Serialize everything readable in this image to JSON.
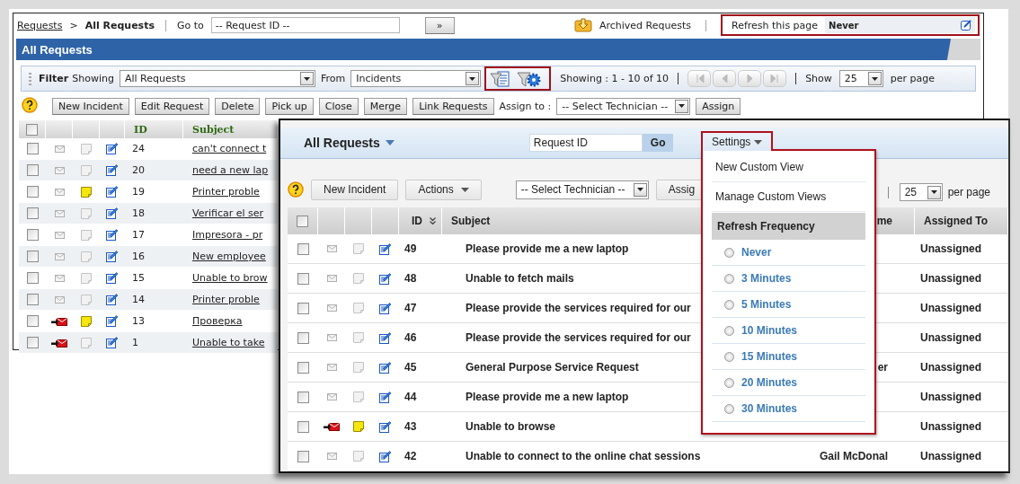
{
  "breadcrumb": {
    "link": "Requests",
    "separator": ">",
    "current": "All Requests"
  },
  "go_to": {
    "label": "Go to",
    "value": "-- Request ID --",
    "button": "»"
  },
  "archived_requests": "Archived Requests",
  "refresh": {
    "label": "Refresh this page",
    "value": "Never",
    "highlighted": true
  },
  "panel_title": "All Requests",
  "filter": {
    "title": "Filter",
    "showing_label": "Showing",
    "view": "All Requests",
    "from_label": "From",
    "module": "Incidents",
    "icons_highlighted": true,
    "range": "Showing : 1 - 10 of 10",
    "show_label": "Show",
    "per_page": "25",
    "per_page_label": "per page"
  },
  "toolbar": {
    "buttons": [
      "New Incident",
      "Edit Request",
      "Delete",
      "Pick up",
      "Close",
      "Merge",
      "Link Requests"
    ],
    "assign_label": "Assign to :",
    "technician": "-- Select Technician --",
    "assign_button": "Assign"
  },
  "table": {
    "select_all_checked": false,
    "columns": [
      "ID",
      "Subject"
    ],
    "rows": [
      {
        "checked": false,
        "new_mail": false,
        "note": false,
        "id": "24",
        "subject": "can't connect t"
      },
      {
        "checked": false,
        "new_mail": false,
        "note": false,
        "id": "20",
        "subject": "need a new lap"
      },
      {
        "checked": false,
        "new_mail": false,
        "note": true,
        "id": "19",
        "subject": "Printer proble"
      },
      {
        "checked": false,
        "new_mail": false,
        "note": false,
        "id": "18",
        "subject": "Verificar el ser"
      },
      {
        "checked": false,
        "new_mail": false,
        "note": false,
        "id": "17",
        "subject": "Impresora - pr"
      },
      {
        "checked": false,
        "new_mail": false,
        "note": false,
        "id": "16",
        "subject": "New employee"
      },
      {
        "checked": false,
        "new_mail": false,
        "note": false,
        "id": "15",
        "subject": "Unable to brow"
      },
      {
        "checked": false,
        "new_mail": false,
        "note": false,
        "id": "14",
        "subject": "Printer proble"
      },
      {
        "checked": false,
        "new_mail": true,
        "note": true,
        "id": "13",
        "subject": "Проверка"
      },
      {
        "checked": false,
        "new_mail": true,
        "note": false,
        "id": "1",
        "subject": "Unable to take"
      }
    ]
  },
  "popup": {
    "title": "All Requests",
    "search": "Request ID",
    "go": "Go",
    "new_button": "New Incident",
    "actions": "Actions",
    "technician": "-- Select Technician --",
    "assign": "Assig",
    "per_page": "25",
    "per_page_label": "per page",
    "select_all_checked": false,
    "columns": [
      "ID",
      "Subject",
      "me",
      "Assigned To"
    ],
    "rows": [
      {
        "checked": false,
        "new_mail": false,
        "note": false,
        "id": "49",
        "subject": "Please provide me a new laptop",
        "assigned": "Unassigned"
      },
      {
        "checked": false,
        "new_mail": false,
        "note": false,
        "id": "48",
        "subject": "Unable to fetch mails",
        "assigned": "Unassigned"
      },
      {
        "checked": false,
        "new_mail": false,
        "note": false,
        "id": "47",
        "subject": "Please provide the services required for our",
        "assigned": "Unassigned"
      },
      {
        "checked": false,
        "new_mail": false,
        "note": false,
        "id": "46",
        "subject": "Please provide the services required for our",
        "assigned": "Unassigned"
      },
      {
        "checked": false,
        "new_mail": false,
        "note": false,
        "id": "45",
        "subject": "General Purpose Service Request",
        "requester": "er",
        "assigned": "Unassigned"
      },
      {
        "checked": false,
        "new_mail": false,
        "note": false,
        "id": "44",
        "subject": "Please provide me a new laptop",
        "assigned": "Unassigned"
      },
      {
        "checked": false,
        "new_mail": true,
        "note": true,
        "id": "43",
        "subject": "Unable to browse",
        "assigned": "Unassigned"
      },
      {
        "checked": false,
        "new_mail": false,
        "note": false,
        "id": "42",
        "subject": "Unable to connect to the online chat sessions",
        "requester": "Gail McDonal",
        "assigned": "Unassigned"
      }
    ],
    "settings": {
      "label": "Settings",
      "highlighted": true,
      "items": [
        "New Custom View",
        "Manage Custom Views"
      ],
      "section": "Refresh Frequency",
      "options": [
        {
          "label": "Never",
          "selected": false
        },
        {
          "label": "3 Minutes",
          "selected": false
        },
        {
          "label": "5 Minutes",
          "selected": false
        },
        {
          "label": "10 Minutes",
          "selected": false
        },
        {
          "label": "15 Minutes",
          "selected": false
        },
        {
          "label": "20 Minutes",
          "selected": false
        },
        {
          "label": "30 Minutes",
          "selected": false
        }
      ]
    }
  }
}
